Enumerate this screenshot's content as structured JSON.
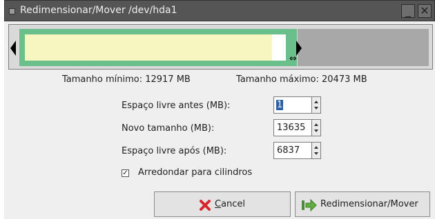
{
  "window": {
    "title": "Redimensionar/Mover /dev/hda1"
  },
  "info": {
    "min_size": "Tamanho mínimo: 12917 MB",
    "max_size": "Tamanho máximo: 20473 MB"
  },
  "fields": {
    "free_before_label": "Espaço livre antes (MB):",
    "free_before_value": "1",
    "new_size_label": "Novo tamanho (MB):",
    "new_size_value": "13635",
    "free_after_label": "Espaço livre após (MB):",
    "free_after_value": "6837"
  },
  "round_cylinders": {
    "label": "Arredondar para cilindros",
    "checked": true,
    "mark": "✓"
  },
  "buttons": {
    "cancel_first": "C",
    "cancel_rest": "ancel",
    "resize": "Redimensionar/Mover"
  },
  "icons": {
    "cancel": "cancel-icon",
    "resize": "resize-arrow-icon"
  },
  "colors": {
    "partition_border": "#6bbf8a",
    "used_space": "#f7f5c0",
    "unallocated": "#a8a8a8"
  }
}
